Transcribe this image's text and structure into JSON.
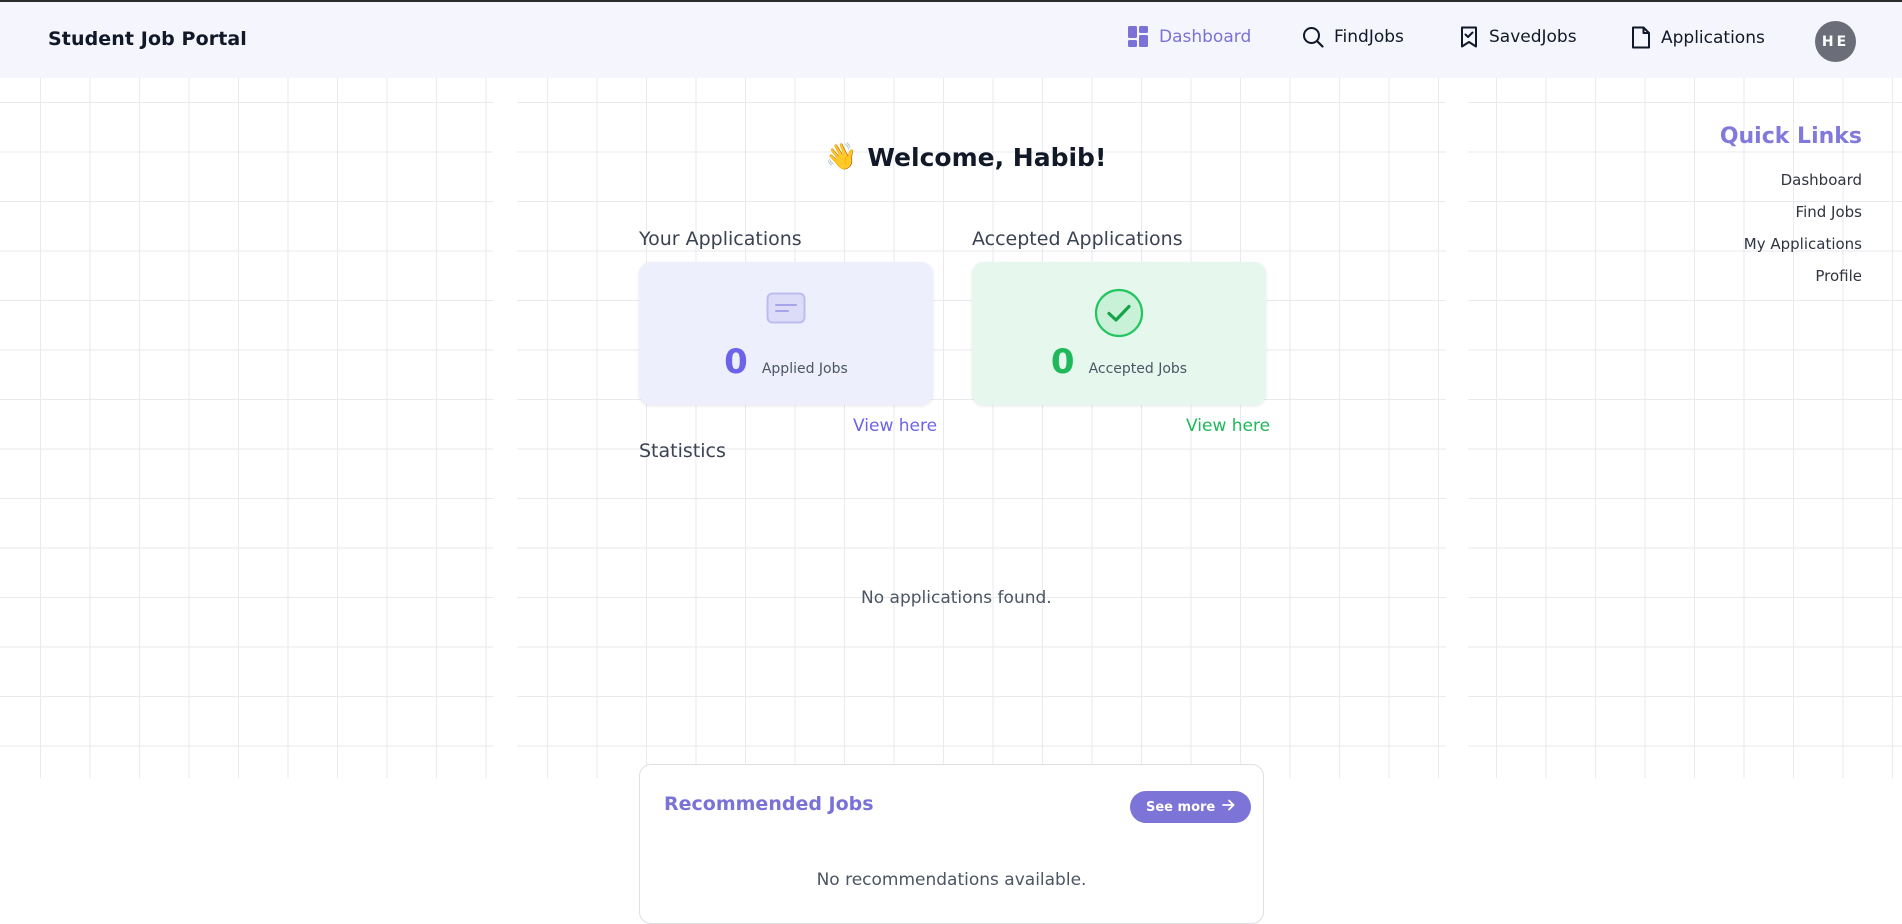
{
  "app": {
    "title": "Student Job Portal"
  },
  "nav": {
    "dashboard": "Dashboard",
    "find_jobs": "FindJobs",
    "saved_jobs": "SavedJobs",
    "applications": "Applications",
    "avatar_initials": "HE"
  },
  "welcome": {
    "emoji": "👋",
    "text": "Welcome, Habib!"
  },
  "sections": {
    "your_applications": "Your Applications",
    "accepted_applications": "Accepted Applications",
    "statistics": "Statistics"
  },
  "cards": {
    "applied": {
      "count": "0",
      "label": "Applied Jobs",
      "link": "View here"
    },
    "accepted": {
      "count": "0",
      "label": "Accepted Jobs",
      "link": "View here"
    }
  },
  "statistics": {
    "empty_message": "No applications found."
  },
  "recommended": {
    "title": "Recommended Jobs",
    "see_more": "See more",
    "empty_message": "No recommendations available."
  },
  "quick_links": {
    "title": "Quick Links",
    "items": [
      "Dashboard",
      "Find Jobs",
      "My Applications",
      "Profile"
    ]
  },
  "colors": {
    "accent": "#7a72d6",
    "applied": "#6c63e8",
    "accepted": "#1fb85b",
    "nav_background": "#f4f5fd"
  },
  "icons": [
    "dashboard-icon",
    "search-icon",
    "bookmark-icon",
    "document-icon",
    "card-icon",
    "check-circle-icon",
    "arrow-right-icon"
  ]
}
